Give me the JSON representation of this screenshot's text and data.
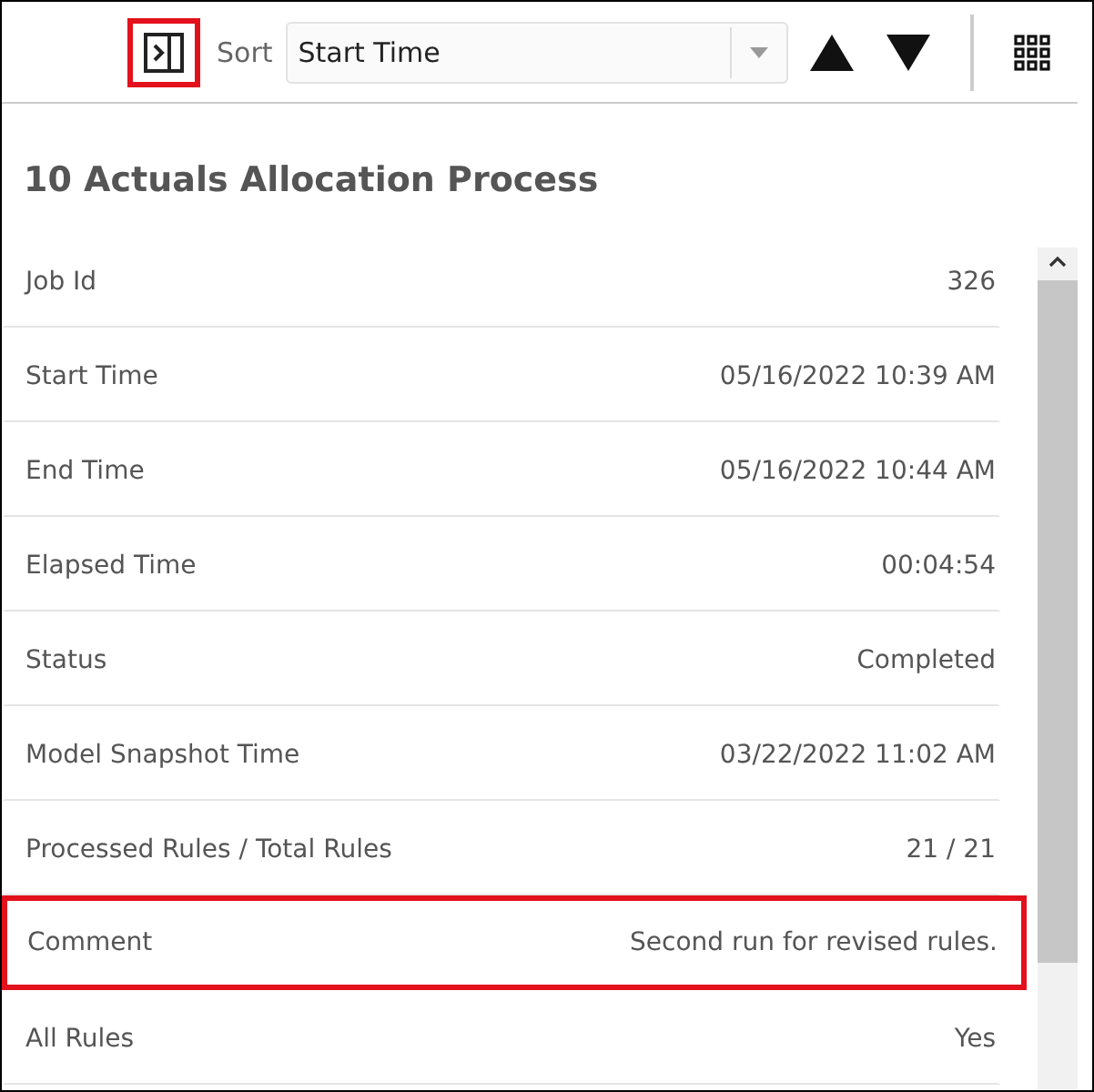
{
  "toolbar": {
    "panel_button": {
      "highlighted": true
    },
    "sort_label": "Sort",
    "sort_value": "Start Time"
  },
  "title": "10 Actuals Allocation Process",
  "rows": [
    {
      "label": "Job Id",
      "value": "326",
      "highlighted": false
    },
    {
      "label": "Start Time",
      "value": "05/16/2022 10:39 AM",
      "highlighted": false
    },
    {
      "label": "End Time",
      "value": "05/16/2022 10:44 AM",
      "highlighted": false
    },
    {
      "label": "Elapsed Time",
      "value": "00:04:54",
      "highlighted": false
    },
    {
      "label": "Status",
      "value": "Completed",
      "highlighted": false
    },
    {
      "label": "Model Snapshot Time",
      "value": "03/22/2022 11:02 AM",
      "highlighted": false
    },
    {
      "label": "Processed Rules / Total Rules",
      "value": "21 / 21",
      "highlighted": false
    },
    {
      "label": "Comment",
      "value": "Second run for revised rules.",
      "highlighted": true
    },
    {
      "label": "All Rules",
      "value": "Yes",
      "highlighted": false
    }
  ]
}
